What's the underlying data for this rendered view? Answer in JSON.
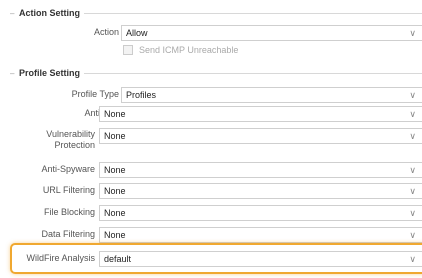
{
  "action_setting": {
    "title": "Action Setting",
    "action_label": "Action",
    "action_value": "Allow",
    "icmp_label": "Send ICMP Unreachable"
  },
  "profile_setting": {
    "title": "Profile Setting",
    "rows": [
      {
        "label": "Profile Type",
        "value": "Profiles"
      },
      {
        "label": "Antivirus",
        "value": "None"
      },
      {
        "label_line1": "Vulnerability",
        "label_line2": "Protection",
        "value": "None"
      },
      {
        "label": "Anti-Spyware",
        "value": "None"
      },
      {
        "label": "URL Filtering",
        "value": "None"
      },
      {
        "label": "File Blocking",
        "value": "None"
      },
      {
        "label": "Data Filtering",
        "value": "None"
      },
      {
        "label": "WildFire Analysis",
        "value": "default"
      }
    ]
  },
  "colors": {
    "highlight": "#f0a830"
  },
  "icons": {
    "collapse": "minus-icon",
    "dropdown": "chevron-down-icon"
  }
}
